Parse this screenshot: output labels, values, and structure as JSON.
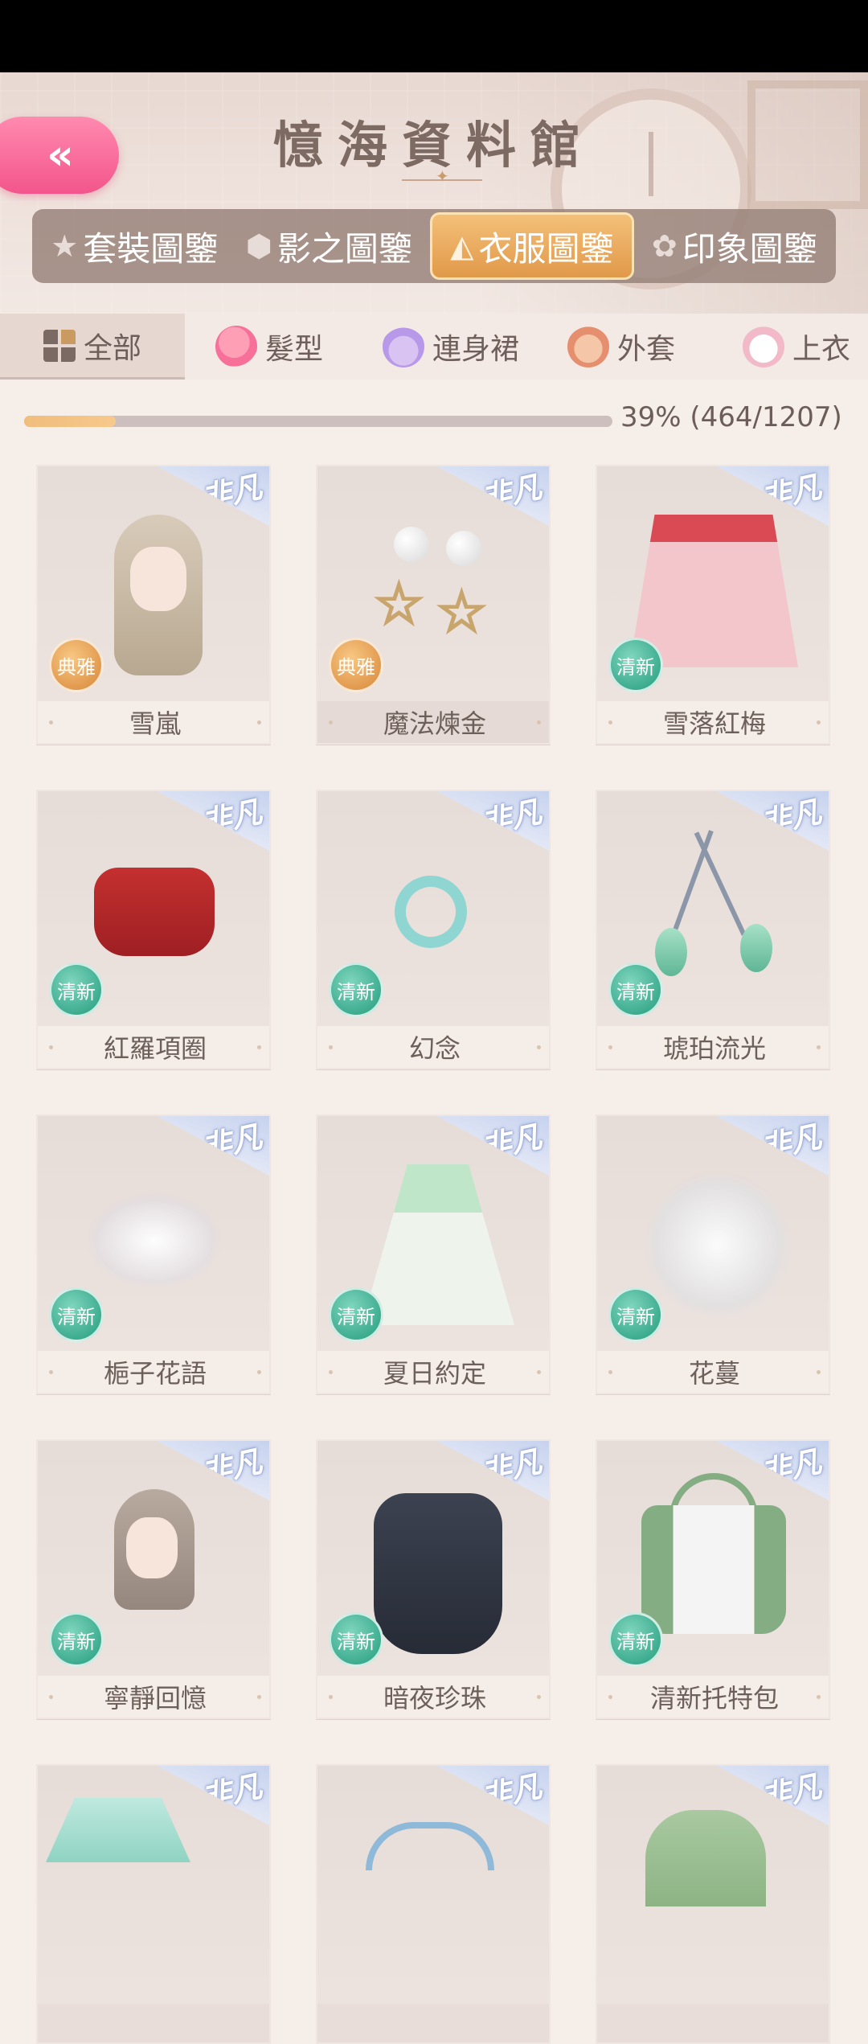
{
  "header": {
    "title": "憶海資料館",
    "back_icon": "«"
  },
  "category_tabs": [
    {
      "label": "套裝圖鑒",
      "icon": "star-icon",
      "glyph": "★"
    },
    {
      "label": "影之圖鑒",
      "icon": "gem-icon",
      "glyph": "⬢"
    },
    {
      "label": "衣服圖鑒",
      "icon": "dress-icon",
      "glyph": "◭"
    },
    {
      "label": "印象圖鑒",
      "icon": "flower-icon",
      "glyph": "✿"
    }
  ],
  "type_tabs": [
    {
      "label": "全部"
    },
    {
      "label": "髮型"
    },
    {
      "label": "連身裙"
    },
    {
      "label": "外套"
    },
    {
      "label": "上衣"
    }
  ],
  "progress": {
    "fraction": 0.39,
    "text": "39% (464/1207)"
  },
  "items": [
    {
      "name": "雪嵐",
      "rarity": "非凡",
      "style": "典雅"
    },
    {
      "name": "魔法煉金",
      "rarity": "非凡",
      "style": "典雅"
    },
    {
      "name": "雪落紅梅",
      "rarity": "非凡",
      "style": "清新"
    },
    {
      "name": "紅羅項圈",
      "rarity": "非凡",
      "style": "清新"
    },
    {
      "name": "幻念",
      "rarity": "非凡",
      "style": "清新"
    },
    {
      "name": "琥珀流光",
      "rarity": "非凡",
      "style": "清新"
    },
    {
      "name": "梔子花語",
      "rarity": "非凡",
      "style": "清新"
    },
    {
      "name": "夏日約定",
      "rarity": "非凡",
      "style": "清新"
    },
    {
      "name": "花蔓",
      "rarity": "非凡",
      "style": "清新"
    },
    {
      "name": "寧靜回憶",
      "rarity": "非凡",
      "style": "清新"
    },
    {
      "name": "暗夜珍珠",
      "rarity": "非凡",
      "style": "清新"
    },
    {
      "name": "清新托特包",
      "rarity": "非凡",
      "style": "清新"
    },
    {
      "name": "",
      "rarity": "非凡",
      "style": ""
    },
    {
      "name": "",
      "rarity": "非凡",
      "style": ""
    },
    {
      "name": "",
      "rarity": "非凡",
      "style": ""
    }
  ],
  "colors": {
    "accent_pink": "#f3558b",
    "active_tab": "#e1994a",
    "fresh_badge": "#3aaa8d",
    "elegant_badge": "#e0974b"
  }
}
